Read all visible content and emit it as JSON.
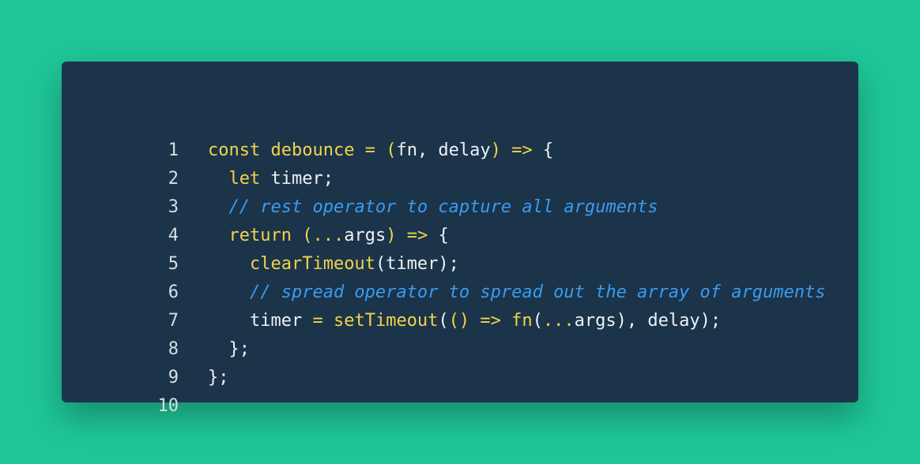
{
  "colors": {
    "background": "#1fc597",
    "card": "#1b344a",
    "keyword": "#f2d34d",
    "comment": "#3b9bf0",
    "text": "#eef2f5"
  },
  "lines": [
    {
      "number": "1",
      "tokens": [
        {
          "text": "const",
          "type": "kw"
        },
        {
          "text": " ",
          "type": "var"
        },
        {
          "text": "debounce",
          "type": "fn"
        },
        {
          "text": " = ",
          "type": "op"
        },
        {
          "text": "(",
          "type": "op"
        },
        {
          "text": "fn, delay",
          "type": "var"
        },
        {
          "text": ")",
          "type": "op"
        },
        {
          "text": " => ",
          "type": "op"
        },
        {
          "text": "{",
          "type": "punc"
        }
      ]
    },
    {
      "number": "2",
      "tokens": [
        {
          "text": "  ",
          "type": "var"
        },
        {
          "text": "let",
          "type": "kw"
        },
        {
          "text": " timer;",
          "type": "var"
        }
      ]
    },
    {
      "number": "3",
      "tokens": [
        {
          "text": "  ",
          "type": "var"
        },
        {
          "text": "// rest operator to capture all arguments",
          "type": "cm"
        }
      ]
    },
    {
      "number": "4",
      "tokens": [
        {
          "text": "  ",
          "type": "var"
        },
        {
          "text": "return",
          "type": "kw"
        },
        {
          "text": " ",
          "type": "var"
        },
        {
          "text": "(...",
          "type": "op"
        },
        {
          "text": "args",
          "type": "var"
        },
        {
          "text": ")",
          "type": "op"
        },
        {
          "text": " => ",
          "type": "op"
        },
        {
          "text": "{",
          "type": "punc"
        }
      ]
    },
    {
      "number": "5",
      "tokens": [
        {
          "text": "    ",
          "type": "var"
        },
        {
          "text": "clearTimeout",
          "type": "fn"
        },
        {
          "text": "(timer);",
          "type": "var"
        }
      ]
    },
    {
      "number": "6",
      "tokens": [
        {
          "text": "    ",
          "type": "var"
        },
        {
          "text": "// spread operator to spread out the array of arguments",
          "type": "cm"
        }
      ]
    },
    {
      "number": "7",
      "tokens": [
        {
          "text": "    timer",
          "type": "var"
        },
        {
          "text": " = ",
          "type": "op"
        },
        {
          "text": "setTimeout",
          "type": "fn"
        },
        {
          "text": "(",
          "type": "var"
        },
        {
          "text": "()",
          "type": "op"
        },
        {
          "text": " => ",
          "type": "op"
        },
        {
          "text": "fn",
          "type": "fn"
        },
        {
          "text": "(",
          "type": "var"
        },
        {
          "text": "...",
          "type": "op"
        },
        {
          "text": "args), delay);",
          "type": "var"
        }
      ]
    },
    {
      "number": "8",
      "tokens": [
        {
          "text": "  };",
          "type": "var"
        }
      ]
    },
    {
      "number": "9",
      "tokens": [
        {
          "text": "};",
          "type": "var"
        }
      ]
    },
    {
      "number": "10",
      "tokens": []
    }
  ]
}
